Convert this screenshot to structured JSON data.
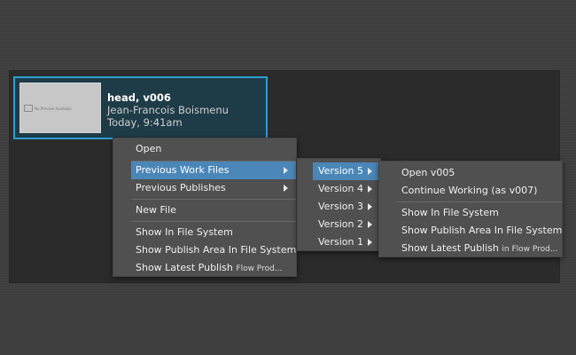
{
  "card": {
    "title": "head, v006",
    "author": "Jean-Francois Boismenu",
    "date": "Today, 9:41am",
    "thumbnail_label": "No Preview Available"
  },
  "main_menu": {
    "items": [
      {
        "label": "Open"
      },
      {
        "label": "Previous Work Files"
      },
      {
        "label": "Previous Publishes"
      },
      {
        "label": "New File"
      },
      {
        "label": "Show In File System"
      },
      {
        "label": "Show Publish Area In File System"
      },
      {
        "label": "Show Latest Publish",
        "suffix": "Flow Prod..."
      }
    ]
  },
  "version_menu": {
    "items": [
      {
        "label": "Version 5"
      },
      {
        "label": "Version 4"
      },
      {
        "label": "Version 3"
      },
      {
        "label": "Version 2"
      },
      {
        "label": "Version 1"
      }
    ]
  },
  "actions_menu": {
    "items": [
      {
        "label": "Open v005"
      },
      {
        "label": "Continue Working (as v007)"
      },
      {
        "label": "Show In File System"
      },
      {
        "label": "Show Publish Area In File System"
      },
      {
        "label": "Show Latest Publish",
        "suffix": "in Flow Prod..."
      }
    ]
  },
  "colors": {
    "selection": "#4a87b8",
    "card_border": "#2b9ed2",
    "card_background": "#1e3b48",
    "menu_background": "#505050"
  }
}
